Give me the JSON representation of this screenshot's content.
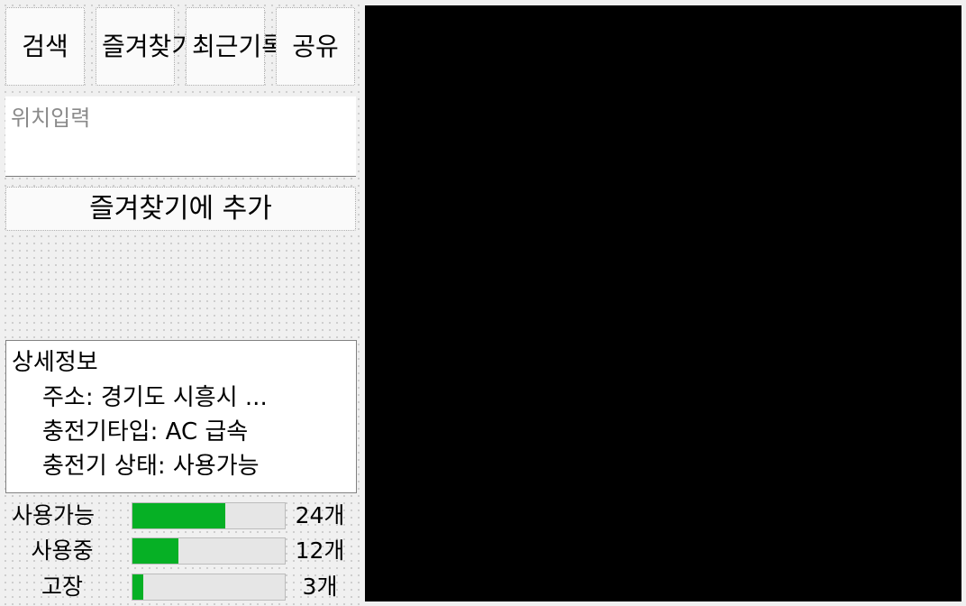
{
  "toolbar": {
    "search_label": "검색",
    "favorites_label": "즐겨찾기",
    "history_label": "최근기록",
    "share_label": "공유"
  },
  "location": {
    "placeholder": "위치입력",
    "value": ""
  },
  "add_favorite_label": "즐겨찾기에 추가",
  "details": {
    "title": "상세정보",
    "address": "주소: 경기도 시흥시 ...",
    "charger_type": "충전기타입: AC 급속",
    "charger_status": "충전기 상태: 사용가능"
  },
  "stats": [
    {
      "label": "사용가능",
      "count": "24개",
      "fraction": 0.61,
      "color": "#06b025"
    },
    {
      "label": "사용중",
      "count": "12개",
      "fraction": 0.3,
      "color": "#06b025"
    },
    {
      "label": "고장",
      "count": "3개",
      "fraction": 0.07,
      "color": "#06b025"
    }
  ],
  "map": {
    "background": "#000000"
  }
}
